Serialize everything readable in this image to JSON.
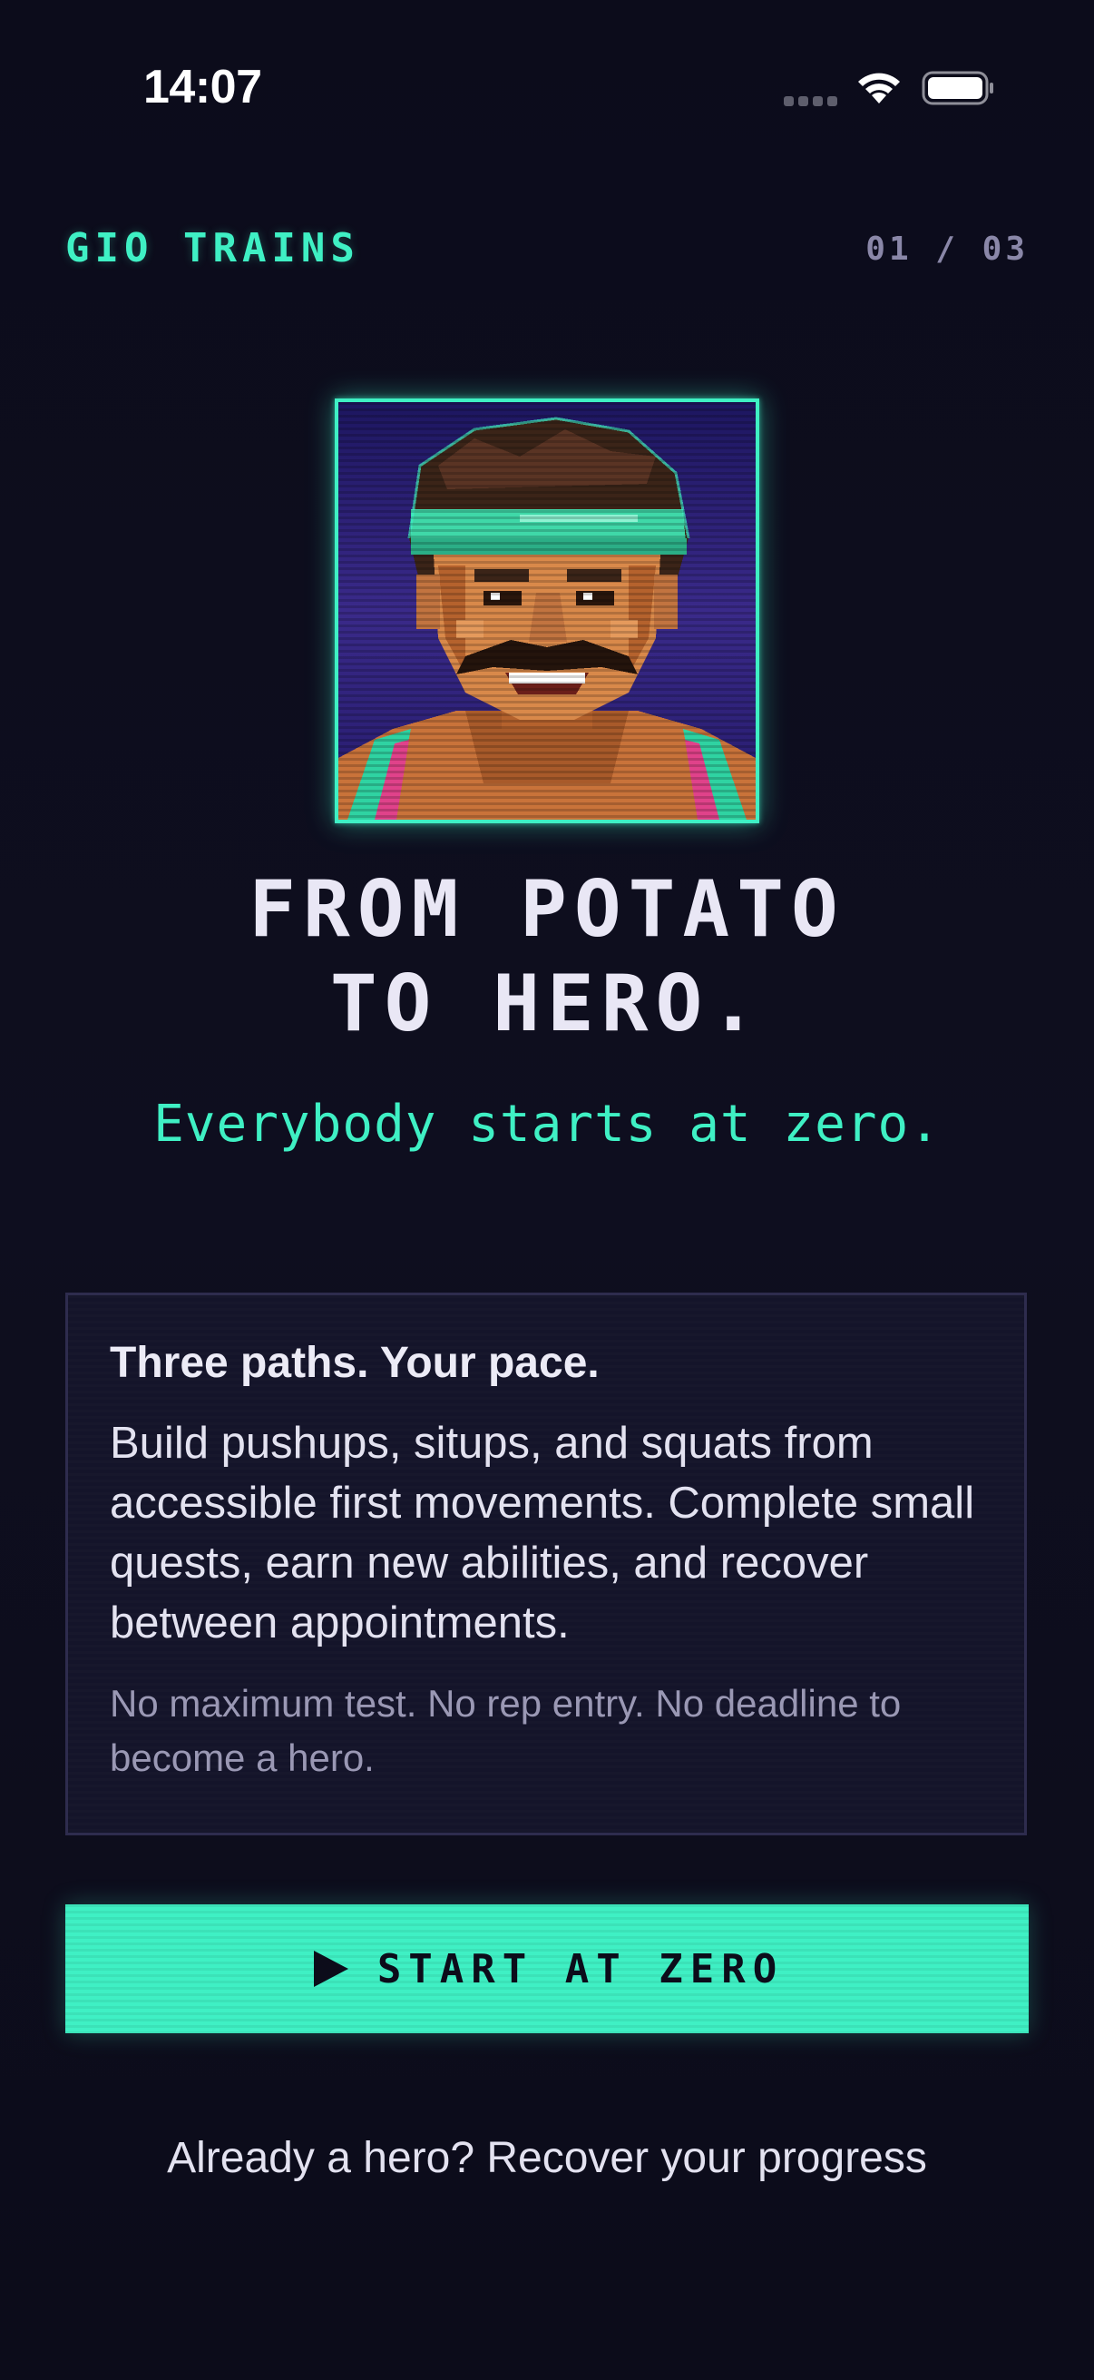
{
  "status_bar": {
    "time": "14:07",
    "wifi_icon": "wifi-icon",
    "battery_icon": "battery-icon",
    "signal_icon": "cellular-signal-icon"
  },
  "header": {
    "brand": "GIO TRAINS",
    "pager": "01 / 03"
  },
  "hero": {
    "portrait_icon": "pixel-art-hero-portrait",
    "headline_line1": "FROM POTATO",
    "headline_line2": "TO HERO.",
    "tagline": "Everybody starts at zero."
  },
  "card": {
    "title": "Three paths. Your pace.",
    "body": "Build pushups, situps, and squats from accessible first movements. Complete small quests, earn new abilities, and recover between appointments.",
    "note": "No maximum test. No rep entry. No deadline to become a hero."
  },
  "cta": {
    "icon": "play-icon",
    "label": "START AT ZERO"
  },
  "recover_link": "Already a hero? Recover your progress",
  "colors": {
    "background": "#0c0c1a",
    "accent": "#3ff0c4",
    "muted": "#8a87a8",
    "card_bg": "#14142a",
    "card_border": "#2e2c4e"
  }
}
